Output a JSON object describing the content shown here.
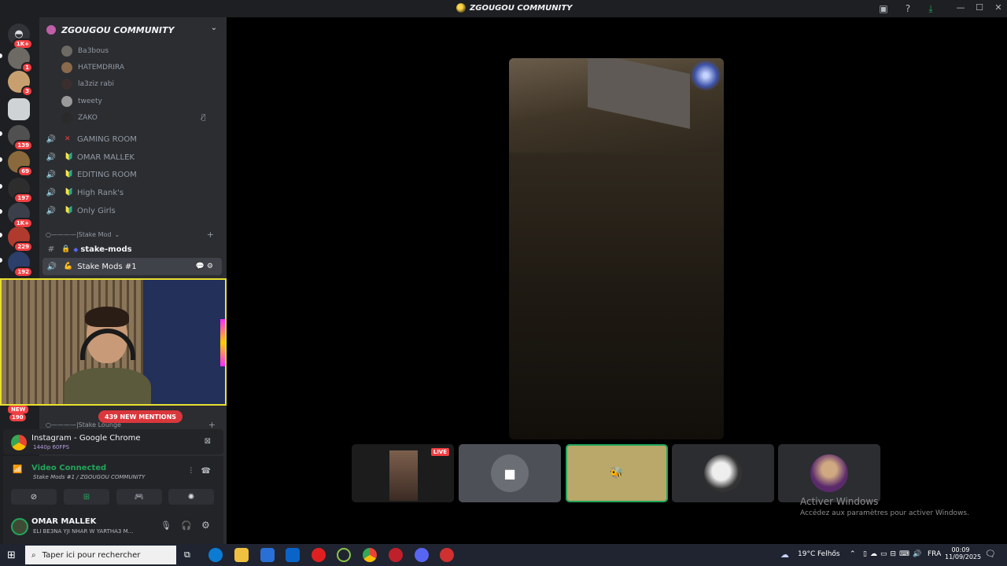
{
  "window": {
    "title": "ZGOUGOU COMMUNITY"
  },
  "server_rail": {
    "badges": [
      "1K+",
      "1",
      "3",
      "139",
      "69",
      "197",
      "1K+",
      "229",
      "192"
    ],
    "new_badge": "NEW",
    "new_count": "190"
  },
  "server": {
    "name": "ZGOUGOU COMMUNITY"
  },
  "members": [
    "Ba3bous",
    "HATEMDRIRA",
    "la3ziz rabi",
    "tweety",
    "ZAKO"
  ],
  "voice_channels": [
    {
      "emoji": "✕",
      "name": "GAMING ROOM",
      "color": "#f23f43"
    },
    {
      "emoji": "🔰",
      "name": "OMAR MALLEK",
      "color": "#e8c200"
    },
    {
      "emoji": "🔰",
      "name": "EDITING ROOM",
      "color": "#e8c200"
    },
    {
      "emoji": "🔰",
      "name": "High Rank's",
      "color": "#e8c200"
    },
    {
      "emoji": "🔰",
      "name": "Only Girls",
      "color": "#e8c200"
    }
  ],
  "category_mod": "○————|Stake Mod",
  "text_channel": "stake-mods",
  "active_voice": "Stake Mods #1",
  "category_lounge": "○————|Stake Lounge",
  "mentions": "439 NEW MENTIONS",
  "stream": {
    "title": "Instagram - Google Chrome",
    "quality": "1440p 60FPS"
  },
  "voice": {
    "status": "Video Connected",
    "location": "Stake Mods #1 / ZGOUGOU COMMUNITY"
  },
  "user": {
    "name": "OMAR MALLEK",
    "status": "ELI BE3NA YJI NHAR W YARTHA3 M..."
  },
  "thumbnails": {
    "live_label": "LIVE"
  },
  "watermark": {
    "line1": "Activer Windows",
    "line2": "Accédez aux paramètres pour activer Windows."
  },
  "taskbar": {
    "search_placeholder": "Taper ici pour rechercher",
    "weather": "19°C",
    "weather_place": "Felhős",
    "lang": "FRA",
    "time": "00:09",
    "date": "11/09/2025",
    "notif_count": "2"
  },
  "colors": {
    "accent": "#5865f2",
    "danger": "#f23f43",
    "connected": "#23a55a",
    "highlight": "#e8e030"
  }
}
